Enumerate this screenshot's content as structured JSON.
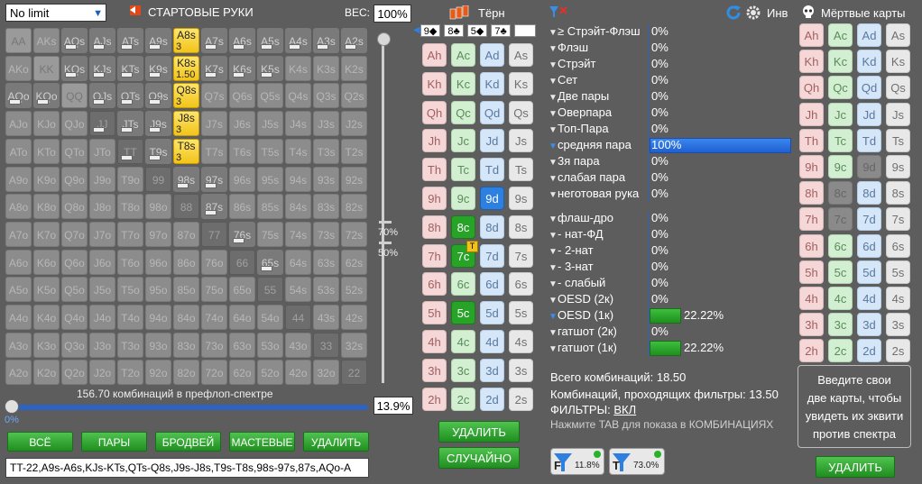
{
  "toolbar": {
    "limit_select": "No limit",
    "starting_hands_label": "СТАРТОВЫЕ РУКИ",
    "weight_label": "ВЕС:",
    "weight_value": "100%"
  },
  "grid": {
    "rows": [
      [
        "AA",
        "AKs",
        "AQs",
        "AJs",
        "ATs",
        "A9s",
        "A8s",
        "A7s",
        "A6s",
        "A5s",
        "A4s",
        "A3s",
        "A2s"
      ],
      [
        "AKo",
        "KK",
        "KQs",
        "KJs",
        "KTs",
        "K9s",
        "K8s",
        "K7s",
        "K6s",
        "K5s",
        "K4s",
        "K3s",
        "K2s"
      ],
      [
        "AQo",
        "KQo",
        "QQ",
        "QJs",
        "QTs",
        "Q9s",
        "Q8s",
        "Q7s",
        "Q6s",
        "Q5s",
        "Q4s",
        "Q3s",
        "Q2s"
      ],
      [
        "AJo",
        "KJo",
        "QJo",
        "JJ",
        "JTs",
        "J9s",
        "J8s",
        "J7s",
        "J6s",
        "J5s",
        "J4s",
        "J3s",
        "J2s"
      ],
      [
        "ATo",
        "KTo",
        "QTo",
        "JTo",
        "TT",
        "T9s",
        "T8s",
        "T7s",
        "T6s",
        "T5s",
        "T4s",
        "T3s",
        "T2s"
      ],
      [
        "A9o",
        "K9o",
        "Q9o",
        "J9o",
        "T9o",
        "99",
        "98s",
        "97s",
        "96s",
        "95s",
        "94s",
        "93s",
        "92s"
      ],
      [
        "A8o",
        "K8o",
        "Q8o",
        "J8o",
        "T8o",
        "98o",
        "88",
        "87s",
        "86s",
        "85s",
        "84s",
        "83s",
        "82s"
      ],
      [
        "A7o",
        "K7o",
        "Q7o",
        "J7o",
        "T7o",
        "97o",
        "87o",
        "77",
        "76s",
        "75s",
        "74s",
        "73s",
        "72s"
      ],
      [
        "A6o",
        "K6o",
        "Q6o",
        "J6o",
        "T6o",
        "96o",
        "86o",
        "76o",
        "66",
        "65s",
        "64s",
        "63s",
        "62s"
      ],
      [
        "A5o",
        "K5o",
        "Q5o",
        "J5o",
        "T5o",
        "95o",
        "85o",
        "75o",
        "65o",
        "55",
        "54s",
        "53s",
        "52s"
      ],
      [
        "A4o",
        "K4o",
        "Q4o",
        "J4o",
        "T4o",
        "94o",
        "84o",
        "74o",
        "64o",
        "54o",
        "44",
        "43s",
        "42s"
      ],
      [
        "A3o",
        "K3o",
        "Q3o",
        "J3o",
        "T3o",
        "93o",
        "83o",
        "73o",
        "63o",
        "53o",
        "43o",
        "33",
        "32s"
      ],
      [
        "A2o",
        "K2o",
        "Q2o",
        "J2o",
        "T2o",
        "92o",
        "82o",
        "72o",
        "62o",
        "52o",
        "42o",
        "32o",
        "22"
      ]
    ],
    "active": [
      "AQs",
      "AJs",
      "ATs",
      "A9s",
      "A7s",
      "A6s",
      "A5s",
      "A4s",
      "A3s",
      "A2s",
      "KQs",
      "KJs",
      "KTs",
      "K9s",
      "K7s",
      "K6s",
      "K5s",
      "QJs",
      "QTs",
      "Q9s",
      "JTs",
      "J9s",
      "T9s",
      "98s",
      "97s",
      "87s",
      "76s",
      "65s",
      "AQo",
      "KQo"
    ],
    "pairs_dark": [
      "JJ",
      "TT",
      "99",
      "88",
      "77",
      "66",
      "55",
      "44",
      "33",
      "22"
    ],
    "gold": {
      "A8s": "3",
      "K8s": "1.50",
      "Q8s": "3",
      "J8s": "3",
      "T8s": "3"
    },
    "bars": [
      "AQs",
      "AJs",
      "ATs",
      "KQs",
      "KJs",
      "KTs",
      "QJs",
      "QTs",
      "JTs",
      "AQo",
      "KQo",
      "T9s",
      "98s",
      "87s",
      "76s",
      "65s",
      "A5s",
      "A4s",
      "A3s",
      "A2s",
      "K6s",
      "K5s",
      "K7s",
      "J9s",
      "Q9s",
      "97s",
      "A9s",
      "A7s",
      "A6s",
      "K9s",
      "JJ",
      "TT"
    ],
    "combos_label": "156.70 комбинаций в префлоп-спектре",
    "spectrum_pct": "13.9%",
    "slider_pct": "0%",
    "scroll_top_pct": "70%",
    "scroll_bot_pct": "50%"
  },
  "buttons": {
    "all": "ВСЁ",
    "pairs": "ПАРЫ",
    "broadway": "БРОДВЕЙ",
    "suited": "МАСТЕВЫЕ",
    "delete": "УДАЛИТЬ"
  },
  "range_text": "TT-22,A9s-A6s,KJs-KTs,QTs-Q8s,J9s-J8s,T9s-T8s,98s-97s,87s,AQo-A",
  "board": {
    "title": "Тёрн",
    "cards": [
      "9◆",
      "8♣",
      "5◆",
      "7♣"
    ],
    "delete_label": "УДАЛИТЬ",
    "random_label": "СЛУЧАЙНО"
  },
  "board_grid": {
    "ranks": [
      "A",
      "K",
      "Q",
      "J",
      "T",
      "9",
      "8",
      "7",
      "6",
      "5",
      "4",
      "3",
      "2"
    ],
    "suits": [
      "h",
      "c",
      "d",
      "s"
    ],
    "selected_green": [
      "8c",
      "7c",
      "5c"
    ],
    "selected_blue": [
      "9d"
    ],
    "turn_badge": "T"
  },
  "filters": {
    "made": [
      {
        "label": "≥ Стрэйт-Флэш",
        "value": "0%"
      },
      {
        "label": "Флэш",
        "value": "0%"
      },
      {
        "label": "Стрэйт",
        "value": "0%"
      },
      {
        "label": "Сет",
        "value": "0%"
      },
      {
        "label": "Две пары",
        "value": "0%"
      },
      {
        "label": "Оверпара",
        "value": "0%"
      },
      {
        "label": "Топ-Пара",
        "value": "0%"
      },
      {
        "label": "средняя пара",
        "value": "100%",
        "highlight": true
      },
      {
        "label": "3я пара",
        "value": "0%"
      },
      {
        "label": "слабая пара",
        "value": "0%"
      },
      {
        "label": "неготовая рука",
        "value": "0%"
      }
    ],
    "draws": [
      {
        "label": "флаш-дро",
        "value": "0%"
      },
      {
        "label": "- нат-ФД",
        "value": "0%"
      },
      {
        "label": "- 2-нат",
        "value": "0%"
      },
      {
        "label": "- 3-нат",
        "value": "0%"
      },
      {
        "label": "- слабый",
        "value": "0%"
      },
      {
        "label": "OESD (2к)",
        "value": "0%"
      },
      {
        "label": "OESD (1к)",
        "value": "22.22%",
        "bar": true,
        "blue": true
      },
      {
        "label": "гатшот (2к)",
        "value": "0%"
      },
      {
        "label": "гатшот (1к)",
        "value": "22.22%",
        "bar": true
      }
    ],
    "total_combos": "Всего комбинаций: 18.50",
    "passing_combos": "Комбинаций, проходящих фильтры: 13.50",
    "filters_label": "ФИЛЬТРЫ:",
    "filters_state": "ВКЛ",
    "hint": "Нажмите TAB для показа в КОМБИНАЦИЯХ",
    "badge_f_pct": "11.8%",
    "badge_t_pct": "73.0%",
    "badge_f": "F",
    "badge_t": "T"
  },
  "right": {
    "inv_label": "Инв",
    "dead_cards_title": "Мёртвые карты",
    "info_text_1": "Введите свои",
    "info_text_2": "две карты, чтобы",
    "info_text_3": "увидеть их эквити",
    "info_text_4": "против спектра",
    "delete_label": "УДАЛИТЬ",
    "dead": [
      "9d",
      "8c",
      "7c"
    ]
  },
  "colors": {
    "accent": "#2f63c2",
    "green": "#27a327",
    "gold": "#f2c41a",
    "panel": "#5d5d5d"
  }
}
